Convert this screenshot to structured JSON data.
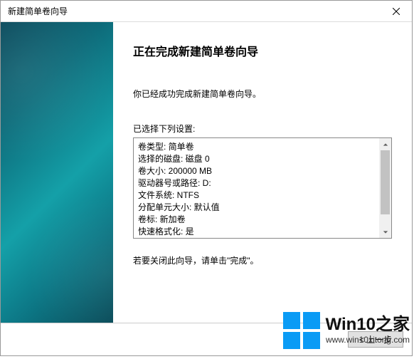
{
  "window": {
    "title": "新建简单卷向导"
  },
  "main": {
    "heading": "正在完成新建简单卷向导",
    "success_text": "你已经成功完成新建简单卷向导。",
    "settings_label": "已选择下列设置:",
    "closing_text": "若要关闭此向导，请单击\"完成\"。"
  },
  "settings": {
    "lines": [
      "卷类型: 简单卷",
      "选择的磁盘: 磁盘 0",
      "卷大小: 200000 MB",
      "驱动器号或路径: D:",
      "文件系统: NTFS",
      "分配单元大小: 默认值",
      "卷标: 新加卷",
      "快速格式化: 是"
    ]
  },
  "buttons": {
    "back": "< 上一步"
  },
  "watermark": {
    "main": "Win10之家",
    "sub": "www.win10xitong.com"
  }
}
